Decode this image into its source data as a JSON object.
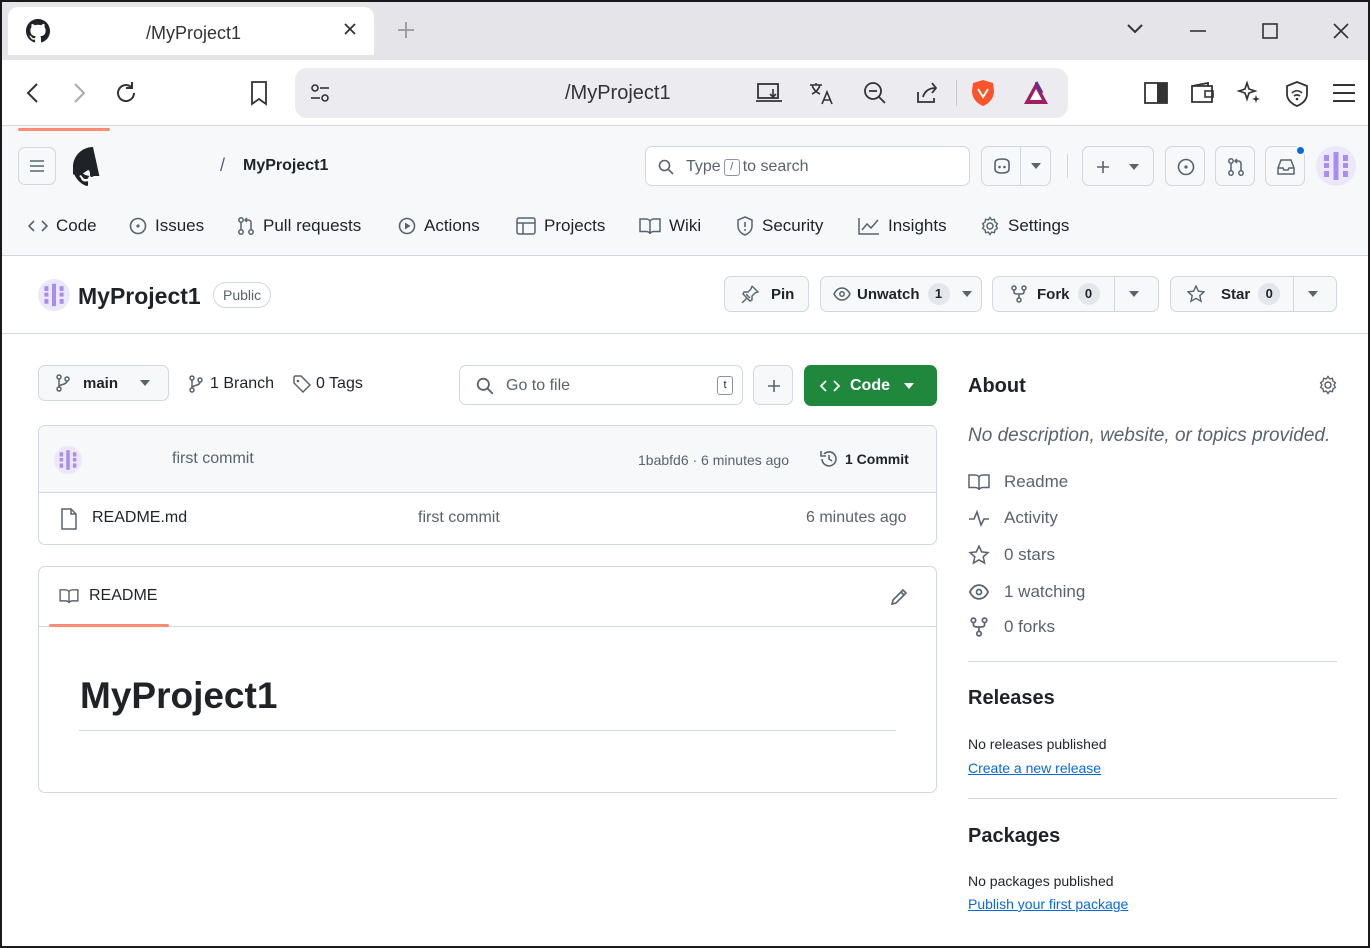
{
  "browser": {
    "tab_title": "/MyProject1",
    "url": "/MyProject1"
  },
  "header": {
    "breadcrumb_sep": "/",
    "repo_name": "MyProject1",
    "search_pre": "Type",
    "search_key": "/",
    "search_post": "to search"
  },
  "nav": [
    {
      "label": "Code",
      "icon": "code-icon"
    },
    {
      "label": "Issues",
      "icon": "issue-icon"
    },
    {
      "label": "Pull requests",
      "icon": "pull-request-icon"
    },
    {
      "label": "Actions",
      "icon": "play-icon"
    },
    {
      "label": "Projects",
      "icon": "table-icon"
    },
    {
      "label": "Wiki",
      "icon": "book-icon"
    },
    {
      "label": "Security",
      "icon": "shield-icon"
    },
    {
      "label": "Insights",
      "icon": "graph-icon"
    },
    {
      "label": "Settings",
      "icon": "gear-icon"
    }
  ],
  "repo": {
    "title": "MyProject1",
    "visibility": "Public",
    "pin_label": "Pin",
    "unwatch_label": "Unwatch",
    "watch_count": "1",
    "fork_label": "Fork",
    "fork_count": "0",
    "star_label": "Star",
    "star_count": "0"
  },
  "files": {
    "branch": "main",
    "branch_count": "1 Branch",
    "tag_count": "0 Tags",
    "goto_placeholder": "Go to file",
    "goto_key": "t",
    "code_label": "Code",
    "commit_message": "first commit",
    "commit_meta": "1babfd6 · 6 minutes ago",
    "commit_count": "1 Commit",
    "rows": [
      {
        "name": "README.md",
        "message": "first commit",
        "time": "6 minutes ago"
      }
    ]
  },
  "readme": {
    "tab_label": "README",
    "heading": "MyProject1"
  },
  "about": {
    "title": "About",
    "description": "No description, website, or topics provided.",
    "items": [
      {
        "label": "Readme",
        "icon": "book-icon"
      },
      {
        "label": "Activity",
        "icon": "pulse-icon"
      },
      {
        "label": "0 stars",
        "icon": "star-icon"
      },
      {
        "label": "1 watching",
        "icon": "eye-icon"
      },
      {
        "label": "0 forks",
        "icon": "fork-icon"
      }
    ]
  },
  "releases": {
    "title": "Releases",
    "empty": "No releases published",
    "link": "Create a new release"
  },
  "packages": {
    "title": "Packages",
    "empty": "No packages published",
    "link": "Publish your first package"
  },
  "colors": {
    "accent_green": "#1f883d",
    "nav_underline": "#fd8c73",
    "link_blue": "#0969da",
    "notification_dot": "#0969da"
  }
}
